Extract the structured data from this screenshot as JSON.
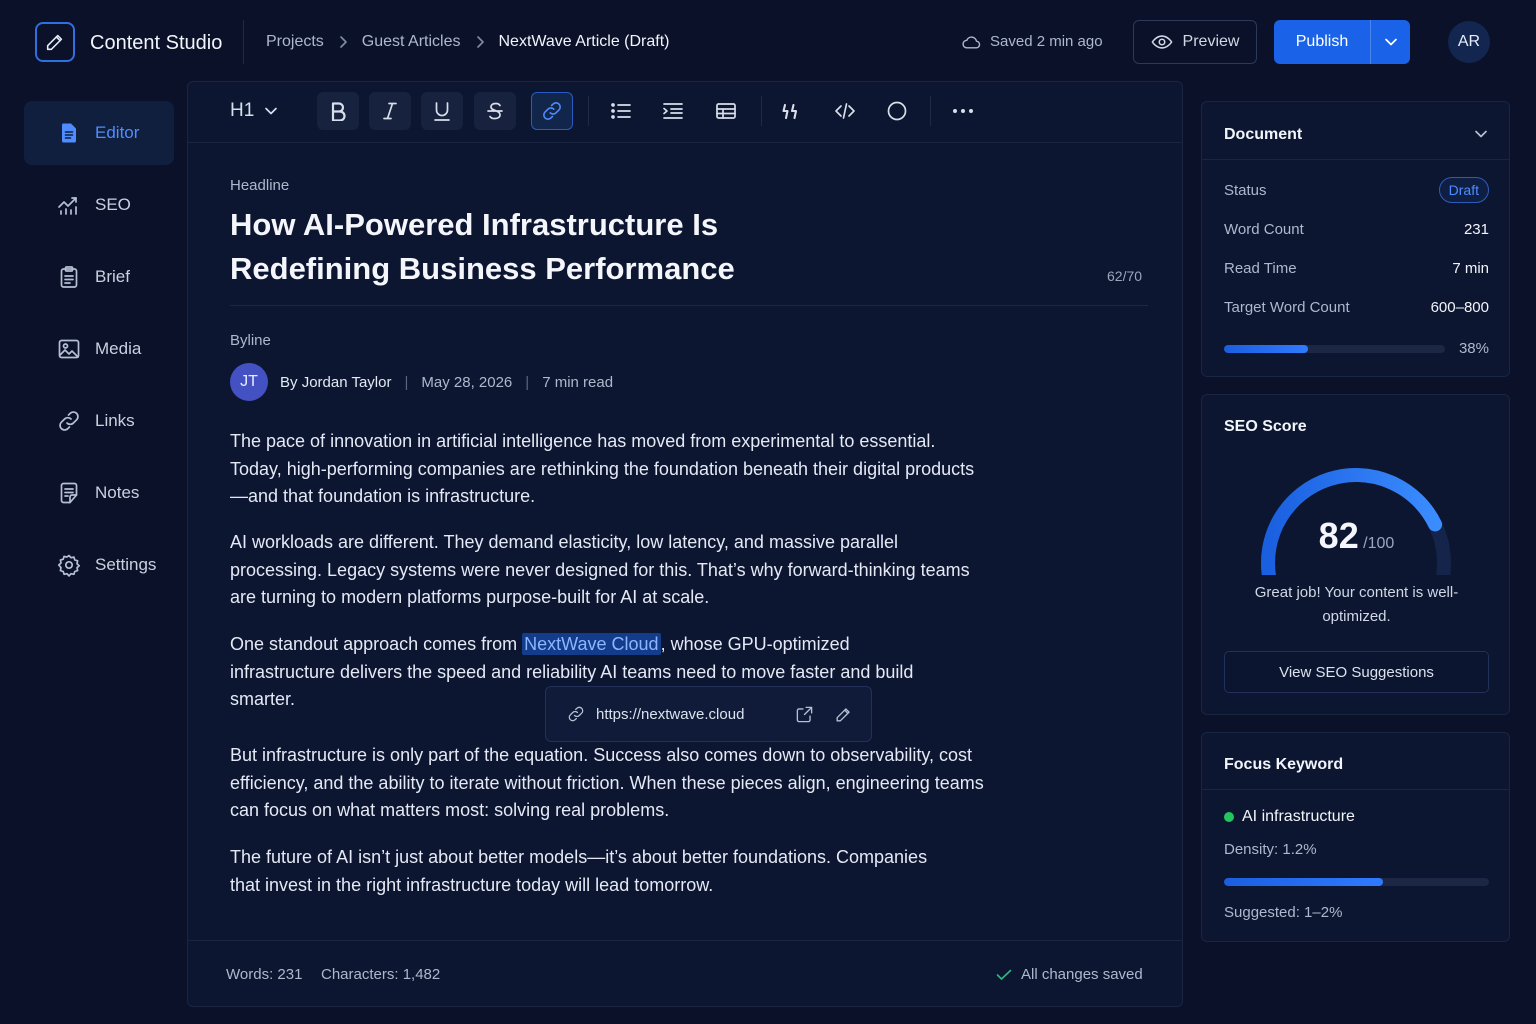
{
  "app": {
    "title": "Content Studio"
  },
  "breadcrumb": [
    "Projects",
    "Guest Articles",
    "NextWave Article (Draft)"
  ],
  "header": {
    "saved_status": "Saved 2 min ago",
    "preview_label": "Preview",
    "publish_label": "Publish",
    "user_initials": "AR"
  },
  "sidebar": {
    "items": [
      {
        "label": "Editor",
        "icon": "editor-icon",
        "active": true
      },
      {
        "label": "SEO",
        "icon": "chart-icon"
      },
      {
        "label": "Brief",
        "icon": "clipboard-icon"
      },
      {
        "label": "Media",
        "icon": "image-icon"
      },
      {
        "label": "Links",
        "icon": "link-icon"
      },
      {
        "label": "Notes",
        "icon": "notes-icon"
      },
      {
        "label": "Settings",
        "icon": "gear-icon"
      }
    ]
  },
  "toolbar": {
    "heading_level": "H1",
    "active_tool": "link"
  },
  "editor": {
    "headline_label": "Headline",
    "headline": "How AI-Powered Infrastructure Is Redefining Business Performance",
    "headline_count": "62/70",
    "byline_label": "Byline",
    "author_initials": "JT",
    "author_by": "By",
    "author_name": "Jordan Taylor",
    "date": "May 28, 2026",
    "read_time": "7 min read",
    "paragraphs": [
      "The pace of innovation in artificial intelligence has moved from experimental to essential. Today, high-performing companies are rethinking the foundation beneath their digital products—and that foundation is infrastructure.",
      "AI workloads are different. They demand elasticity, low latency, and massive parallel processing. Legacy systems were never designed for this. That’s why forward-thinking teams are turning to modern platforms purpose-built for AI at scale.",
      {
        "before": "One standout approach comes from ",
        "link": "NextWave Cloud",
        "after": ", whose GPU-optimized infrastructure delivers the speed and reliability AI teams need to move faster and build smarter."
      },
      "But infrastructure is only part of the equation. Success also comes down to observability, cost efficiency, and the ability to iterate without friction. When these pieces align, engineering teams can focus on what matters most: solving real problems.",
      "The future of AI isn’t just about better models—it’s about better foundations. Companies that invest in the right infrastructure today will lead tomorrow."
    ],
    "link_url": "https://nextwave.cloud"
  },
  "footer": {
    "words": "Words: 231",
    "characters": "Characters: 1,482",
    "save_status": "All changes saved"
  },
  "document": {
    "title": "Document",
    "status_label": "Status",
    "status_value": "Draft",
    "word_count_label": "Word Count",
    "word_count_value": "231",
    "read_time_label": "Read Time",
    "read_time_value": "7 min",
    "target_label": "Target Word Count",
    "target_value": "600–800",
    "progress_text": "38%",
    "progress": 0.38
  },
  "seo": {
    "title": "SEO Score",
    "score": "82",
    "score_max": "/100",
    "score_fraction": 0.82,
    "message": "Great job! Your content is well-optimized.",
    "button_label": "View SEO Suggestions"
  },
  "focus_keyword": {
    "title": "Focus Keyword",
    "keyword": "AI infrastructure",
    "density": "Density: 1.2%",
    "density_fraction": 0.6,
    "suggested": "Suggested: 1–2%"
  },
  "colors": {
    "accent": "#1a63e8",
    "background": "#0a1128",
    "panel": "#0c1630",
    "keyword_dot": "#22c55e"
  }
}
